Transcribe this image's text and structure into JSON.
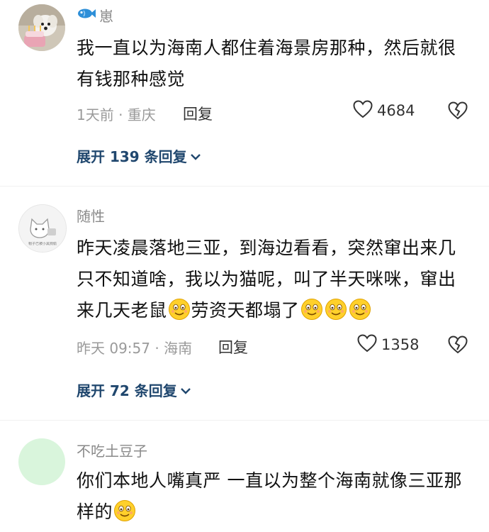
{
  "comments": [
    {
      "username": "崽",
      "text": "我一直以为海南人都住着海景房那种，然后就很有钱那种感觉",
      "time_location": "1天前 · 重庆",
      "reply_label": "回复",
      "likes": "4684",
      "expand_label": "展开 139 条回复"
    },
    {
      "username": "随性",
      "avatar_caption": "帽子已被小黑狗偷",
      "text_part1": "昨天凌晨落地三亚，到海边看看，突然窜出来几只不知道啥，我以为猫呢，叫了半天咪咪，窜出来几天老鼠",
      "text_part2": "劳资天都塌了",
      "time_location": "昨天 09:57 · 海南",
      "reply_label": "回复",
      "likes": "1358",
      "expand_label": "展开 72 条回复"
    },
    {
      "username": "不吃土豆子",
      "text": "你们本地人嘴真严 一直以为整个海南就像三亚那样的",
      "avatar_color": "#d9f5dc"
    }
  ],
  "colors": {
    "link": "#20476e",
    "meta": "#9a9a9a",
    "username": "#8a8a8a"
  }
}
